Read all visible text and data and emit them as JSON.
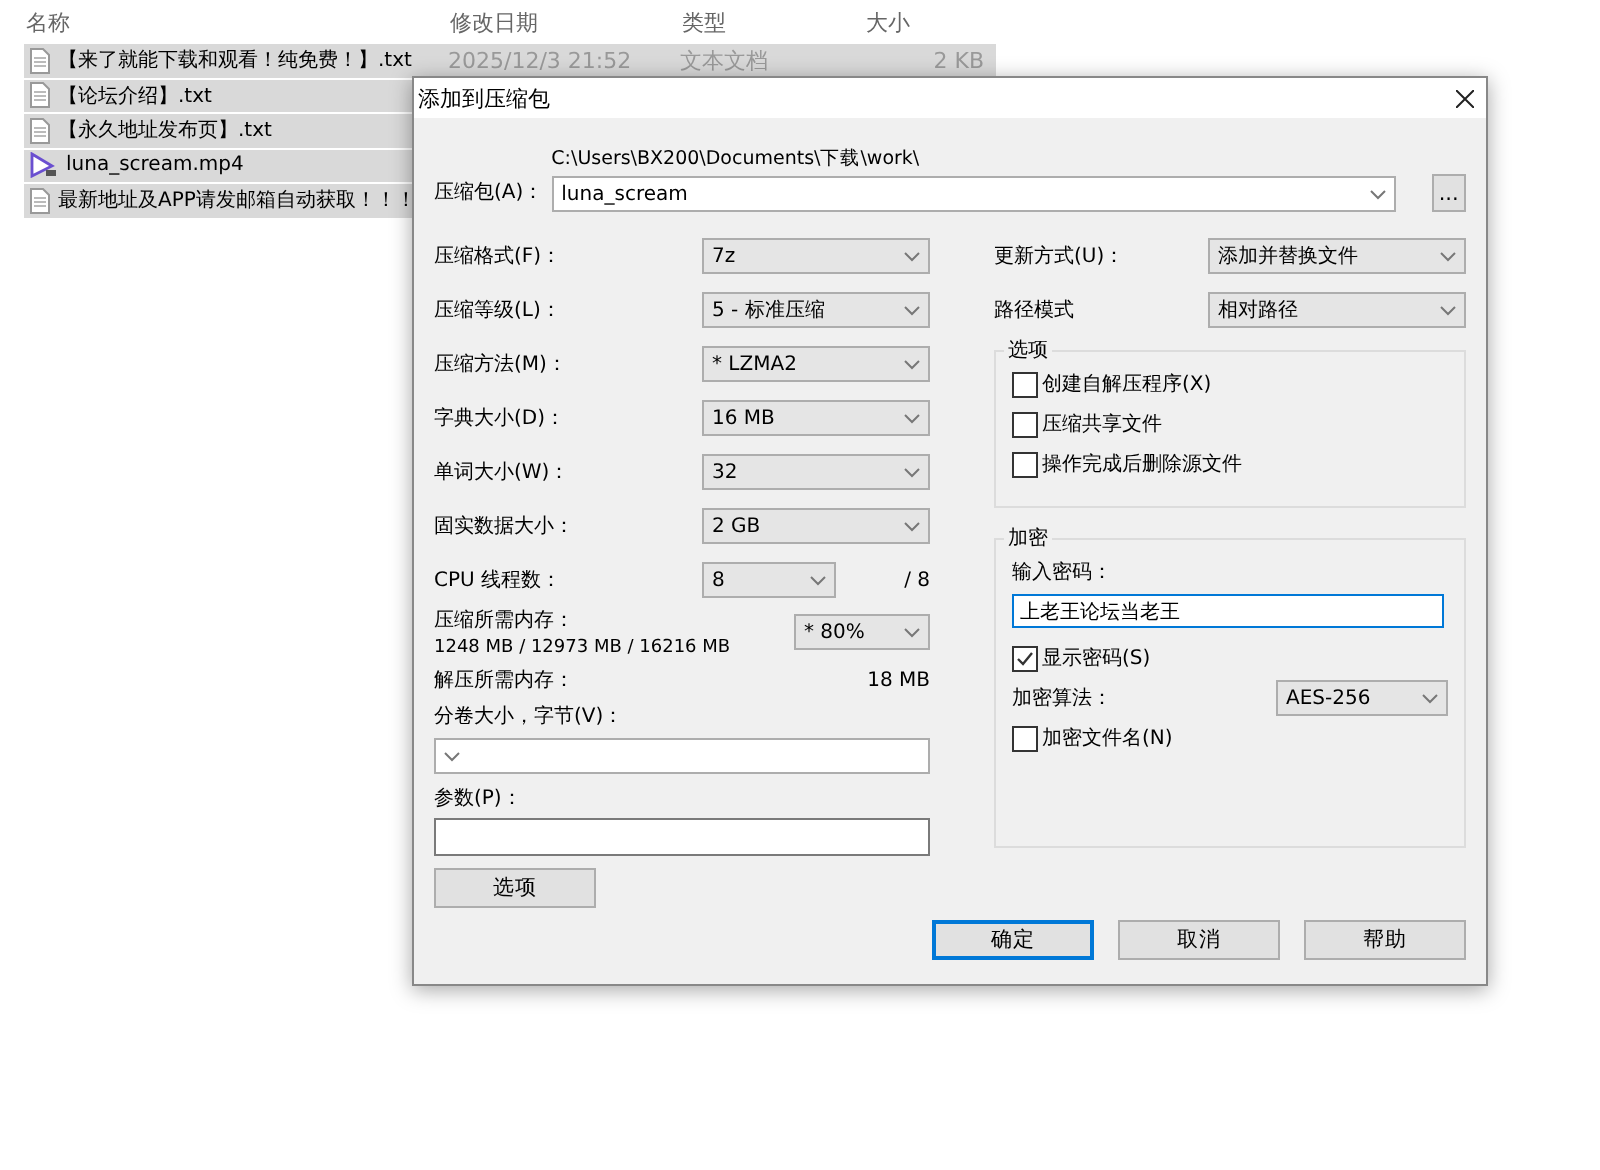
{
  "explorer": {
    "columns": [
      "名称",
      "修改日期",
      "类型",
      "大小"
    ],
    "files": [
      {
        "name": "【来了就能下载和观看！纯免费！】.txt",
        "kind": "text",
        "date": "2025/12/3 21:52",
        "type": "文本文档",
        "size": "2 KB",
        "selected": true
      },
      {
        "name": "【论坛介绍】.txt",
        "kind": "text",
        "selected": true
      },
      {
        "name": "【永久地址发布页】.txt",
        "kind": "text",
        "selected": true
      },
      {
        "name": "luna_scream.mp4",
        "kind": "video",
        "selected": true
      },
      {
        "name": "最新地址及APP请发邮箱自动获取！！！",
        "kind": "text",
        "selected": true
      }
    ]
  },
  "dialog": {
    "title": "添加到压缩包",
    "archive": {
      "label": "压缩包(A)：",
      "path": "C:\\Users\\BX200\\Documents\\下载\\work\\",
      "value": "luna_scream",
      "browse": "..."
    },
    "fields": [
      {
        "label": "压缩格式(F)：",
        "value": "7z"
      },
      {
        "label": "压缩等级(L)：",
        "value": "5 - 标准压缩"
      },
      {
        "label": "压缩方法(M)：",
        "value": "* LZMA2"
      },
      {
        "label": "字典大小(D)：",
        "value": "16 MB"
      },
      {
        "label": "单词大小(W)：",
        "value": "32"
      },
      {
        "label": "固实数据大小：",
        "value": "2 GB"
      }
    ],
    "threads": {
      "label": "CPU 线程数：",
      "value": "8",
      "max": "/ 8"
    },
    "memory": {
      "label": "压缩所需内存：",
      "detail": "1248 MB / 12973 MB / 16216 MB",
      "value": "* 80%"
    },
    "decompress": {
      "label": "解压所需内存：",
      "value": "18 MB"
    },
    "volume": {
      "label": "分卷大小，字节(V)："
    },
    "params": {
      "label": "参数(P)："
    },
    "options_button": "选项",
    "update": {
      "label": "更新方式(U)：",
      "value": "添加并替换文件"
    },
    "path_mode": {
      "label": "路径模式",
      "value": "相对路径"
    },
    "options": {
      "title": "选项",
      "checkboxes": [
        {
          "label": "创建自解压程序(X)",
          "checked": false
        },
        {
          "label": "压缩共享文件",
          "checked": false
        },
        {
          "label": "操作完成后删除源文件",
          "checked": false
        }
      ]
    },
    "encryption": {
      "title": "加密",
      "password_label": "输入密码：",
      "password": "上老王论坛当老王",
      "show_password": {
        "label": "显示密码(S)",
        "checked": true
      },
      "method": {
        "label": "加密算法：",
        "value": "AES-256"
      },
      "encrypt_names": {
        "label": "加密文件名(N)",
        "checked": false
      }
    },
    "buttons": [
      {
        "label": "确定",
        "default": true
      },
      {
        "label": "取消",
        "default": false
      },
      {
        "label": "帮助",
        "default": false
      }
    ]
  }
}
